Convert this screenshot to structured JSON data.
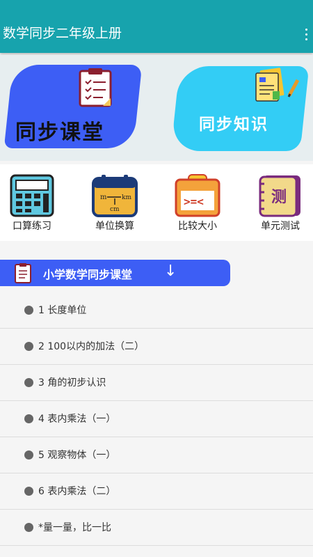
{
  "app_bar": {
    "title": "数学同步二年级上册",
    "overflow_icon": "more-vert-icon"
  },
  "banner": {
    "left_card": {
      "label": "同步课堂",
      "icon": "clipboard-icon",
      "color": "#3d5ef5"
    },
    "right_card": {
      "label": "同步知识",
      "icon": "notes-icon",
      "color": "#33cdf5"
    }
  },
  "quick_actions": [
    {
      "label": "口算练习",
      "icon": "calculator-icon"
    },
    {
      "label": "单位换算",
      "icon": "unit-calendar-icon",
      "icon_text_top": "m",
      "icon_text_mid": "km",
      "icon_text_bottom": "cm"
    },
    {
      "label": "比较大小",
      "icon": "compare-icon",
      "icon_text": ">=<"
    },
    {
      "label": "单元测试",
      "icon": "test-book-icon",
      "icon_text": "测"
    }
  ],
  "section": {
    "title": "小学数学同步课堂",
    "arrow": "↓"
  },
  "lessons": [
    {
      "text": "1  长度单位"
    },
    {
      "text": "2  100以内的加法（二）"
    },
    {
      "text": "3  角的初步认识"
    },
    {
      "text": "4  表内乘法（一）"
    },
    {
      "text": "5  观察物体（一）"
    },
    {
      "text": "6  表内乘法（二）"
    },
    {
      "text": "*量一量，比一比"
    }
  ],
  "colors": {
    "app_bar": "#17a3ad",
    "accent_blue": "#3d5ef5",
    "accent_cyan": "#33cdf5"
  }
}
